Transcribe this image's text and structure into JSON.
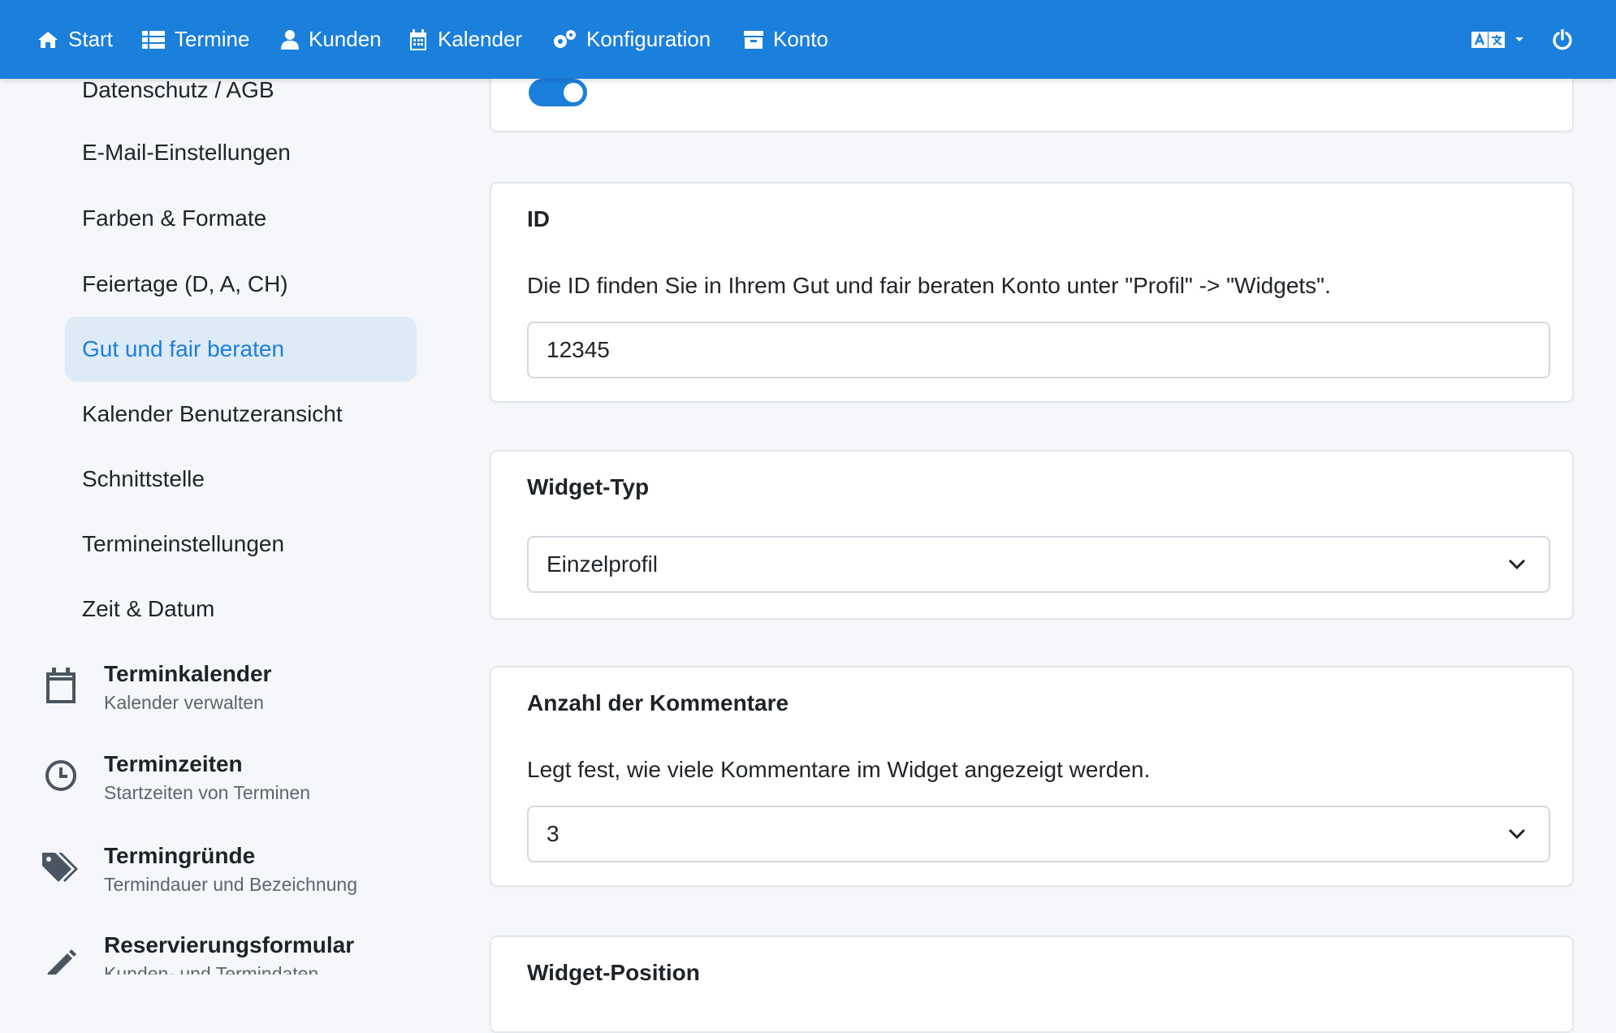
{
  "navbar": {
    "items": [
      {
        "label": "Start",
        "icon": "home-icon"
      },
      {
        "label": "Termine",
        "icon": "list-icon"
      },
      {
        "label": "Kunden",
        "icon": "user-icon"
      },
      {
        "label": "Kalender",
        "icon": "calendar-icon"
      },
      {
        "label": "Konfiguration",
        "icon": "gears-icon"
      },
      {
        "label": "Konto",
        "icon": "archive-icon"
      }
    ],
    "language_icon": "translate-icon",
    "power_icon": "power-icon"
  },
  "sidebar": {
    "sub_items": [
      {
        "label": "Datenschutz / AGB"
      },
      {
        "label": "E-Mail-Einstellungen"
      },
      {
        "label": "Farben & Formate"
      },
      {
        "label": "Feiertage (D, A, CH)"
      },
      {
        "label": "Gut und fair beraten",
        "active": true
      },
      {
        "label": "Kalender Benutzeransicht"
      },
      {
        "label": "Schnittstelle"
      },
      {
        "label": "Termineinstellungen"
      },
      {
        "label": "Zeit & Datum"
      }
    ],
    "sections": [
      {
        "title": "Terminkalender",
        "subtitle": "Kalender verwalten",
        "icon": "calendar-outline-icon"
      },
      {
        "title": "Terminzeiten",
        "subtitle": "Startzeiten von Terminen",
        "icon": "clock-icon"
      },
      {
        "title": "Termingründe",
        "subtitle": "Termindauer und Bezeichnung",
        "icon": "tags-icon"
      },
      {
        "title": "Reservierungsformular",
        "subtitle": "Kunden- und Termindaten",
        "icon": "pencil-icon"
      }
    ]
  },
  "main": {
    "toggle": {
      "on": true
    },
    "id_card": {
      "title": "ID",
      "description": "Die ID finden Sie in Ihrem Gut und fair beraten Konto unter \"Profil\" -> \"Widgets\".",
      "value": "12345"
    },
    "widget_type_card": {
      "title": "Widget-Typ",
      "selected": "Einzelprofil"
    },
    "comments_card": {
      "title": "Anzahl der Kommentare",
      "description": "Legt fest, wie viele Kommentare im Widget angezeigt werden.",
      "selected": "3"
    },
    "position_card": {
      "title": "Widget-Position"
    }
  },
  "colors": {
    "primary": "#1b7fdc",
    "active_bg": "#deebf7",
    "page_bg": "#f6f7fa"
  }
}
